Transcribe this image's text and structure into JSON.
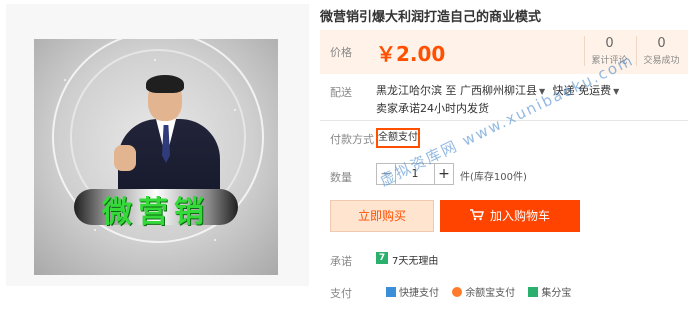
{
  "product": {
    "title": "微营销引爆大利润打造自己的商业模式",
    "image_caption": "微营销"
  },
  "price": {
    "label": "价格",
    "value": "￥2.00"
  },
  "stats": [
    {
      "num": "0",
      "label": "累计评论"
    },
    {
      "num": "0",
      "label": "交易成功"
    }
  ],
  "shipping": {
    "label": "配送",
    "from": "黑龙江哈尔滨",
    "to_word": "至",
    "destination": "广西柳州柳江县",
    "method": "快递 免运费",
    "note": "卖家承诺24小时内发货"
  },
  "payment": {
    "label": "付款方式",
    "option": "全额支付"
  },
  "quantity": {
    "label": "数量",
    "minus": "−",
    "value": "1",
    "plus": "+",
    "stock": "件(库存100件)"
  },
  "actions": {
    "buy": "立即购买",
    "cart": "加入购物车"
  },
  "promise": {
    "label": "承诺",
    "badge": "7",
    "text": "7天无理由"
  },
  "pay_methods": {
    "label": "支付",
    "items": [
      "快捷支付",
      "余额宝支付",
      "集分宝"
    ]
  },
  "watermark": "虚拟资库网 www.xunibaoku.com",
  "colors": {
    "accent": "#ff5000",
    "cart_button": "#ff4400",
    "price_bg": "#fff2e8",
    "logo_green": "#36d93a"
  }
}
